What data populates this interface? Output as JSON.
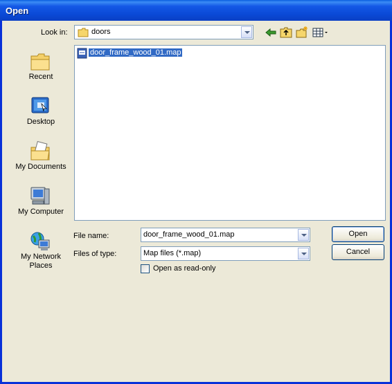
{
  "window": {
    "title": "Open"
  },
  "toolbar": {
    "lookin_label": "Look in:",
    "lookin_value": "doors",
    "icons": [
      "back-arrow-icon",
      "up-folder-icon",
      "new-folder-icon",
      "view-menu-icon"
    ]
  },
  "places": [
    {
      "name": "recent",
      "label": "Recent"
    },
    {
      "name": "desktop",
      "label": "Desktop"
    },
    {
      "name": "my-documents",
      "label": "My Documents"
    },
    {
      "name": "my-computer",
      "label": "My Computer"
    },
    {
      "name": "my-network-places",
      "label": "My Network Places"
    }
  ],
  "files": [
    {
      "name": "door_frame_wood_01.map",
      "selected": true
    }
  ],
  "form": {
    "filename_label": "File name:",
    "filename_value": "door_frame_wood_01.map",
    "filetype_label": "Files of type:",
    "filetype_value": "Map files (*.map)",
    "readonly_label": "Open as read-only"
  },
  "buttons": {
    "open": "Open",
    "cancel": "Cancel"
  },
  "colors": {
    "titlebar": "#0a49d6",
    "selection": "#316ac5",
    "dialog_bg": "#ece9d8"
  }
}
